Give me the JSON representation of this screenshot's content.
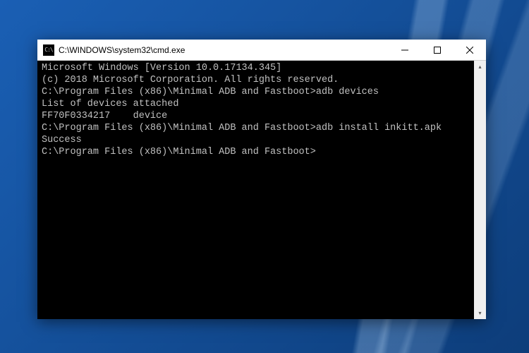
{
  "window": {
    "title": "C:\\WINDOWS\\system32\\cmd.exe"
  },
  "console": {
    "lines": [
      "Microsoft Windows [Version 10.0.17134.345]",
      "(c) 2018 Microsoft Corporation. All rights reserved.",
      "",
      "C:\\Program Files (x86)\\Minimal ADB and Fastboot>adb devices",
      "List of devices attached",
      "FF70F0334217    device",
      "",
      "C:\\Program Files (x86)\\Minimal ADB and Fastboot>adb install inkitt.apk",
      "Success",
      "",
      "C:\\Program Files (x86)\\Minimal ADB and Fastboot>"
    ]
  }
}
